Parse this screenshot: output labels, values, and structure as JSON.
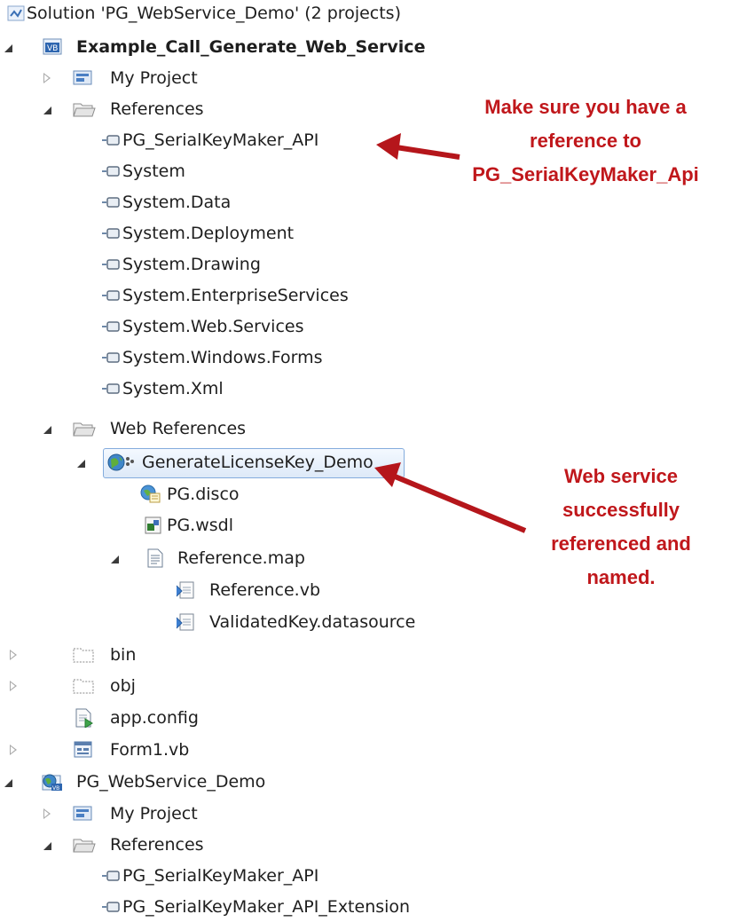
{
  "tree": {
    "solution": "Solution 'PG_WebService_Demo' (2 projects)",
    "project1": "Example_Call_Generate_Web_Service",
    "my_project": "My Project",
    "references": "References",
    "refs1": [
      "PG_SerialKeyMaker_API",
      "System",
      "System.Data",
      "System.Deployment",
      "System.Drawing",
      "System.EnterpriseServices",
      "System.Web.Services",
      "System.Windows.Forms",
      "System.Xml"
    ],
    "web_references": "Web References",
    "web_service": "GenerateLicenseKey_Demo",
    "disco": "PG.disco",
    "wsdl": "PG.wsdl",
    "reference_map": "Reference.map",
    "reference_vb": "Reference.vb",
    "datasource": "ValidatedKey.datasource",
    "bin": "bin",
    "obj": "obj",
    "app_config": "app.config",
    "form1": "Form1.vb",
    "project2": "PG_WebService_Demo",
    "my_project2": "My Project",
    "references2": "References",
    "refs2": [
      "PG_SerialKeyMaker_API",
      "PG_SerialKeyMaker_API_Extension"
    ]
  },
  "annotations": {
    "reference_note": [
      "Make sure you have a",
      "reference to",
      "PG_SerialKeyMaker_Api"
    ],
    "webservice_note": [
      "Web service",
      "successfully",
      "referenced and",
      "named."
    ]
  },
  "colors": {
    "annotation": "#c0171b",
    "selection_border": "#84acdd"
  }
}
